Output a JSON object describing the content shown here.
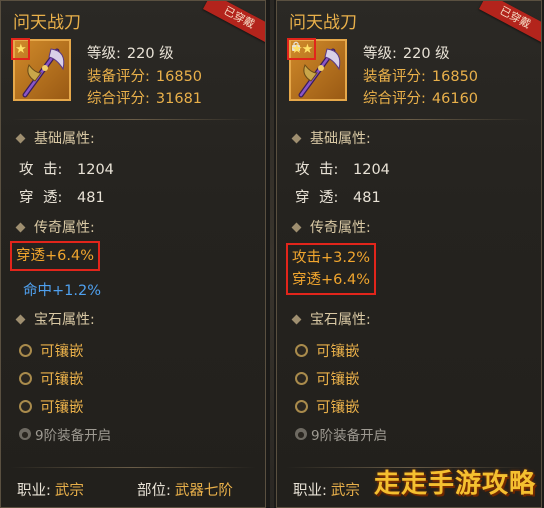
{
  "left": {
    "title": "问天战刀",
    "equipped_tag": "已穿戴",
    "stars": "★",
    "level_label": "等级:",
    "level_value": "220 级",
    "equip_score_label": "装备评分:",
    "equip_score_value": "16850",
    "total_score_label": "综合评分:",
    "total_score_value": "31681",
    "base_title": "基础属性:",
    "attack_k1": "攻",
    "attack_k2": "击:",
    "attack_value": "1204",
    "pierce_k1": "穿",
    "pierce_k2": "透:",
    "pierce_value": "481",
    "legend_title": "传奇属性:",
    "legend_lines": [
      "穿透+6.4%"
    ],
    "legend_blue": "命中+1.2%",
    "gem_title": "宝石属性:",
    "gems": [
      "可镶嵌",
      "可镶嵌",
      "可镶嵌"
    ],
    "unlock_text": "9阶装备开启",
    "job_label": "职业:",
    "job_value": "武宗",
    "slot_label": "部位:",
    "slot_value": "武器七阶"
  },
  "right": {
    "title": "问天战刀",
    "equipped_tag": "已穿戴",
    "stars": "★★",
    "level_label": "等级:",
    "level_value": "220 级",
    "equip_score_label": "装备评分:",
    "equip_score_value": "16850",
    "total_score_label": "综合评分:",
    "total_score_value": "46160",
    "base_title": "基础属性:",
    "attack_k1": "攻",
    "attack_k2": "击:",
    "attack_value": "1204",
    "pierce_k1": "穿",
    "pierce_k2": "透:",
    "pierce_value": "481",
    "legend_title": "传奇属性:",
    "legend_lines": [
      "攻击+3.2%",
      "穿透+6.4%"
    ],
    "gem_title": "宝石属性:",
    "gems": [
      "可镶嵌",
      "可镶嵌",
      "可镶嵌"
    ],
    "unlock_text": "9阶装备开启",
    "job_label": "职业:",
    "job_value": "武宗"
  },
  "watermark": "走走手游攻略",
  "colors": {
    "gold": "#e9b04a",
    "highlight_border": "#e2251b",
    "legend_orange": "#f0a52e",
    "legend_blue": "#4fa0ee",
    "equipped_ribbon": "#b3241c"
  },
  "icons": {
    "weapon": "halberd-weapon-icon",
    "star": "star-icon",
    "lock": "lock-icon",
    "socket": "gem-socket-icon"
  }
}
